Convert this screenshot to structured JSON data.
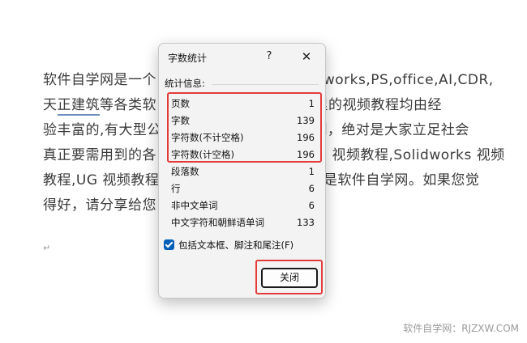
{
  "document": {
    "lines": [
      {
        "text": "软件自学网是一个",
        "tail": ",Solidworks,PS,office,AI,CDR,"
      },
      {
        "pre": "天",
        "underlined": "正建筑",
        "post": "等各类软",
        "tail": "，本站里的视频教程均由经"
      },
      {
        "text": "验丰富的,有大型公",
        "tail": "录制，绝对是大家立足社会"
      },
      {
        "text": "真正要需用到的各",
        "tail": "D 视频教程,Solidworks 视频"
      },
      {
        "text": "教程,UG 视频教程",
        "tail": "然是软件自学网。如果您觉"
      },
      {
        "text": "得好，请分享给您",
        "tail": ""
      }
    ],
    "pilcrow": "↵"
  },
  "dialog": {
    "title": "字数统计",
    "help_label": "?",
    "close_glyph": "✕",
    "section_label": "统计信息:",
    "stats": [
      {
        "label": "页数",
        "value": "1"
      },
      {
        "label": "字数",
        "value": "139"
      },
      {
        "label": "字符数(不计空格)",
        "value": "196"
      },
      {
        "label": "字符数(计空格)",
        "value": "196"
      },
      {
        "label": "段落数",
        "value": "1"
      },
      {
        "label": "行",
        "value": "6"
      },
      {
        "label": "非中文单词",
        "value": "6"
      },
      {
        "label": "中文字符和朝鲜语单词",
        "value": "133"
      }
    ],
    "checkbox_label": "包括文本框、脚注和尾注(F)",
    "checkbox_checked": true,
    "close_button_label": "关闭"
  },
  "watermark": "软件自学网：RJZXW.COM",
  "colors": {
    "highlight": "#e33b3b",
    "checkbox": "#005fb8"
  }
}
